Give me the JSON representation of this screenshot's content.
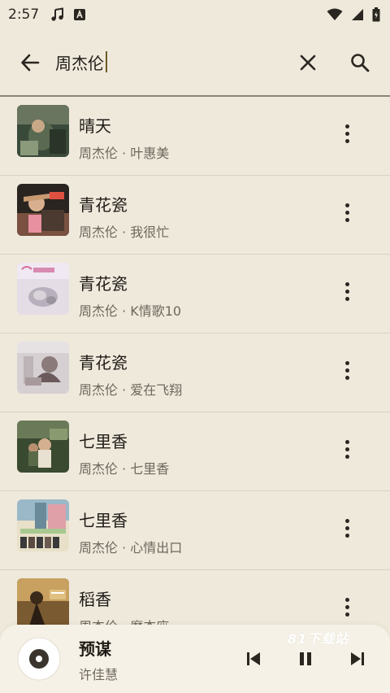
{
  "status_bar": {
    "time": "2:57",
    "icons": [
      "music-note-icon",
      "text-a-icon",
      "wifi-icon",
      "signal-icon",
      "battery-icon"
    ]
  },
  "search": {
    "query": "周杰伦",
    "back_icon": "arrow-left-icon",
    "clear_icon": "close-icon",
    "search_icon": "search-icon"
  },
  "songs": [
    {
      "title": "晴天",
      "subtitle": "周杰伦 · 叶惠美"
    },
    {
      "title": "青花瓷",
      "subtitle": "周杰伦 · 我很忙"
    },
    {
      "title": "青花瓷",
      "subtitle": "周杰伦 · K情歌10"
    },
    {
      "title": "青花瓷",
      "subtitle": "周杰伦 · 爱在飞翔"
    },
    {
      "title": "七里香",
      "subtitle": "周杰伦 · 七里香"
    },
    {
      "title": "七里香",
      "subtitle": "周杰伦 · 心情出口"
    },
    {
      "title": "稻香",
      "subtitle": "周杰伦 · 魔杰座"
    }
  ],
  "now_playing": {
    "title": "预谋",
    "artist": "许佳慧",
    "controls": [
      "skip-previous-icon",
      "pause-icon",
      "skip-next-icon"
    ]
  },
  "watermark": "81下载站",
  "colors": {
    "background": "#efe9dc",
    "player_background": "#f6f1e6",
    "primary_text": "#1f1b16",
    "secondary_text": "#6e675c",
    "divider": "#d9d2c3",
    "caret": "#6b5a2a"
  }
}
